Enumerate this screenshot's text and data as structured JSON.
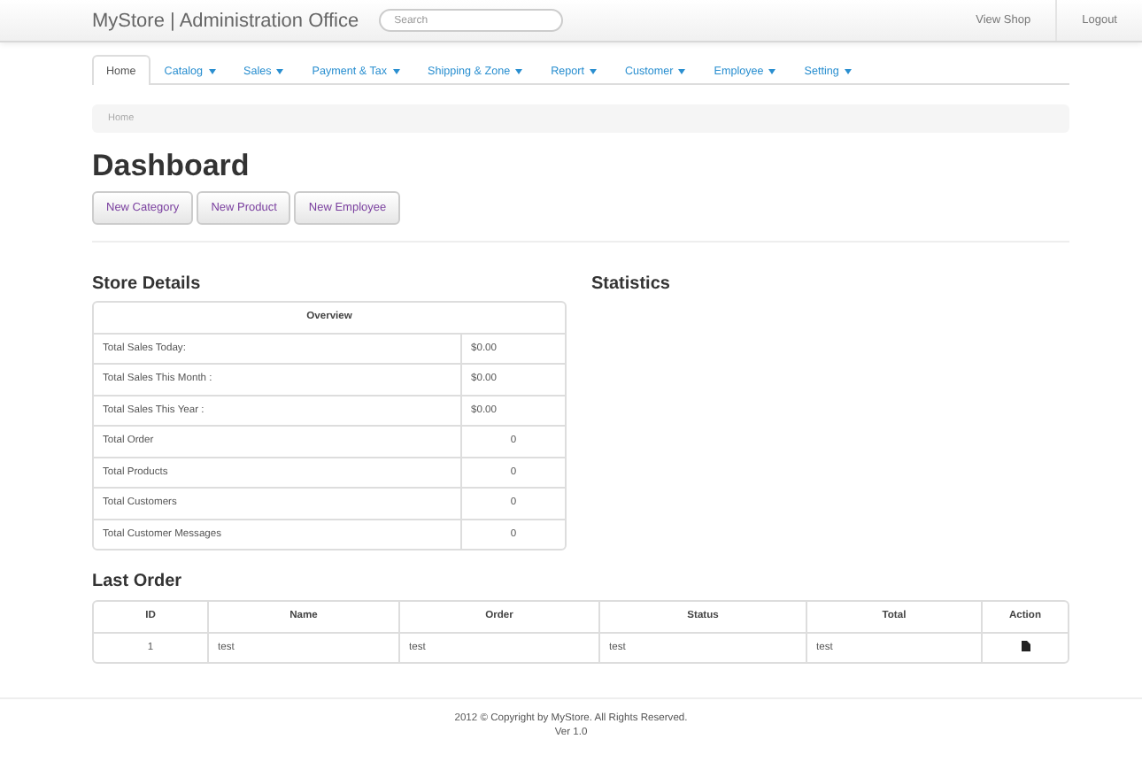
{
  "navbar": {
    "brand": "MyStore | Administration Office",
    "search": {
      "placeholder": "Search"
    },
    "links": [
      "View Shop",
      "Logout"
    ]
  },
  "tabs": [
    {
      "label": "Home",
      "selected": true,
      "dropdown": false
    },
    {
      "label": "Catalog",
      "selected": false,
      "dropdown": true
    },
    {
      "label": "Sales",
      "selected": false,
      "dropdown": true
    },
    {
      "label": "Payment & Tax",
      "selected": false,
      "dropdown": true
    },
    {
      "label": "Shipping & Zone",
      "selected": false,
      "dropdown": true
    },
    {
      "label": "Report",
      "selected": false,
      "dropdown": true
    },
    {
      "label": "Customer",
      "selected": false,
      "dropdown": true
    },
    {
      "label": "Employee",
      "selected": false,
      "dropdown": true
    },
    {
      "label": "Setting",
      "selected": false,
      "dropdown": true
    }
  ],
  "breadcrumb": "Home",
  "title": "Dashboard",
  "buttons": [
    "New Category",
    "New Product",
    "New Employee"
  ],
  "store_details": {
    "heading": "Store Details",
    "table_title": "Overview",
    "rows": [
      {
        "label": "Total Sales Today:",
        "value": "$0.00",
        "kind": "money"
      },
      {
        "label": "Total Sales This Month :",
        "value": "$0.00",
        "kind": "money"
      },
      {
        "label": "Total Sales This Year :",
        "value": "$0.00",
        "kind": "money"
      },
      {
        "label": "Total Order",
        "value": "0",
        "kind": "count"
      },
      {
        "label": "Total Products",
        "value": "0",
        "kind": "count"
      },
      {
        "label": "Total Customers",
        "value": "0",
        "kind": "count"
      },
      {
        "label": "Total Customer Messages",
        "value": "0",
        "kind": "count"
      }
    ]
  },
  "statistics": {
    "heading": "Statistics"
  },
  "last_order": {
    "heading": "Last Order",
    "columns": [
      "ID",
      "Name",
      "Order",
      "Status",
      "Total",
      "Action"
    ],
    "rows": [
      {
        "id": "1",
        "name": "test",
        "order": "test",
        "status": "test",
        "total": "test"
      }
    ]
  },
  "footer": {
    "copyright": "2012 © Copyright by MyStore. All Rights Reserved.",
    "version": "Ver 1.0"
  }
}
